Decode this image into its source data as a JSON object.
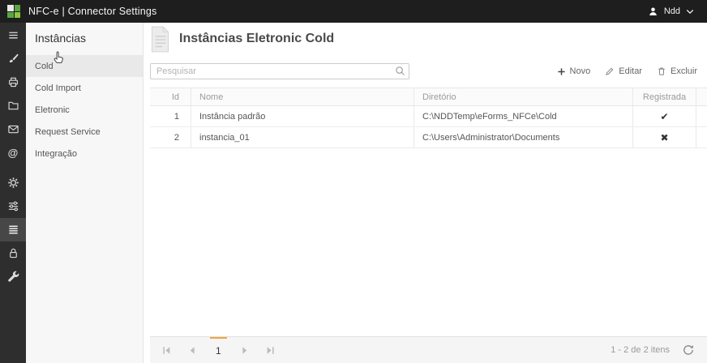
{
  "topbar": {
    "title": "NFC-e | Connector Settings",
    "user_label": "Ndd"
  },
  "icon_rail": {
    "items": [
      "menu-icon",
      "brush-icon",
      "printer-icon",
      "folder-icon",
      "mail-icon",
      "at-icon",
      "gear-icon",
      "sliders-icon",
      "rows-icon",
      "lock-icon",
      "wrench-icon"
    ],
    "selected_index": 8
  },
  "nav": {
    "title": "Instâncias",
    "items": [
      {
        "label": "Cold",
        "selected": true
      },
      {
        "label": "Cold Import",
        "selected": false
      },
      {
        "label": "Eletronic",
        "selected": false
      },
      {
        "label": "Request Service",
        "selected": false
      },
      {
        "label": "Integração",
        "selected": false
      }
    ]
  },
  "main": {
    "title": "Instâncias Eletronic Cold",
    "search": {
      "placeholder": "Pesquisar"
    },
    "toolbar": [
      {
        "label": "Novo",
        "icon": "plus-icon"
      },
      {
        "label": "Editar",
        "icon": "pencil-icon"
      },
      {
        "label": "Excluir",
        "icon": "trash-icon"
      }
    ],
    "table": {
      "columns": [
        "Id",
        "Nome",
        "Diretório",
        "Registrada"
      ],
      "rows": [
        {
          "id": "1",
          "nome": "Instância padrão",
          "diretorio": "C:\\NDDTemp\\eForms_NFCe\\Cold",
          "registrada": "check"
        },
        {
          "id": "2",
          "nome": "instancia_01",
          "diretorio": "C:\\Users\\Administrator\\Documents",
          "registrada": "cross"
        }
      ]
    },
    "pager": {
      "current_page": "1",
      "info": "1 - 2 de 2 itens"
    }
  },
  "glyphs": {
    "check": "✔",
    "cross": "✖"
  },
  "colors": {
    "topbar_bg": "#1e1e1e",
    "rail_bg": "#2e2e2e",
    "accent_green": "#5ba543",
    "nav_bg": "#f7f7f7",
    "nav_selected_bg": "#e9e9e9",
    "pager_accent": "#f0a63c",
    "status_mark": "#333333"
  }
}
